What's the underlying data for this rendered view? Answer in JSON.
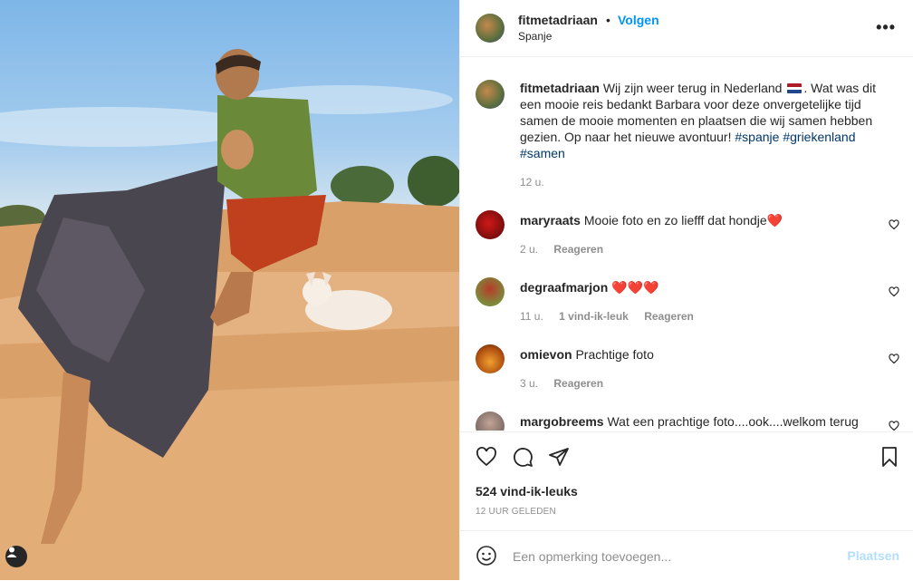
{
  "post": {
    "author": "fitmetadriaan",
    "dot": "•",
    "follow_label": "Volgen",
    "location": "Spanje",
    "more_label": "•••",
    "caption_text": "Wij zijn weer terug in Nederland",
    "caption_rest": ". Wat was dit een mooie reis bedankt Barbara voor deze onvergetelijke tijd samen de mooie momenten en plaatsen die wij samen hebben gezien. Op naar het nieuwe avontuur! ",
    "hashtags": [
      "#spanje",
      "#griekenland",
      "#samen"
    ],
    "caption_time": "12 u.",
    "likes": "524 vind-ik-leuks",
    "posted_ago": "12 UUR GELEDEN",
    "flag_icon": "netherlands-flag-icon"
  },
  "comments": [
    {
      "user": "maryraats",
      "text": "Mooie foto en zo liefff dat hondje❤️",
      "time": "2 u.",
      "likes": "",
      "reply": "Reageren"
    },
    {
      "user": "degraafmarjon",
      "text": "❤️❤️❤️",
      "time": "11 u.",
      "likes": "1 vind-ik-leuk",
      "reply": "Reageren"
    },
    {
      "user": "omievon",
      "text": "Prachtige foto",
      "time": "3 u.",
      "likes": "",
      "reply": "Reageren"
    },
    {
      "user": "margobreems",
      "text": "Wat een prachtige foto....ook....welkom terug",
      "time": "",
      "likes": "",
      "reply": ""
    }
  ],
  "composer": {
    "placeholder": "Een opmerking toevoegen...",
    "post_label": "Plaatsen"
  },
  "colors": {
    "link": "#0095f6",
    "hashtag": "#00376b",
    "muted": "#8e8e8e",
    "post_disabled": "#b2dffc"
  }
}
